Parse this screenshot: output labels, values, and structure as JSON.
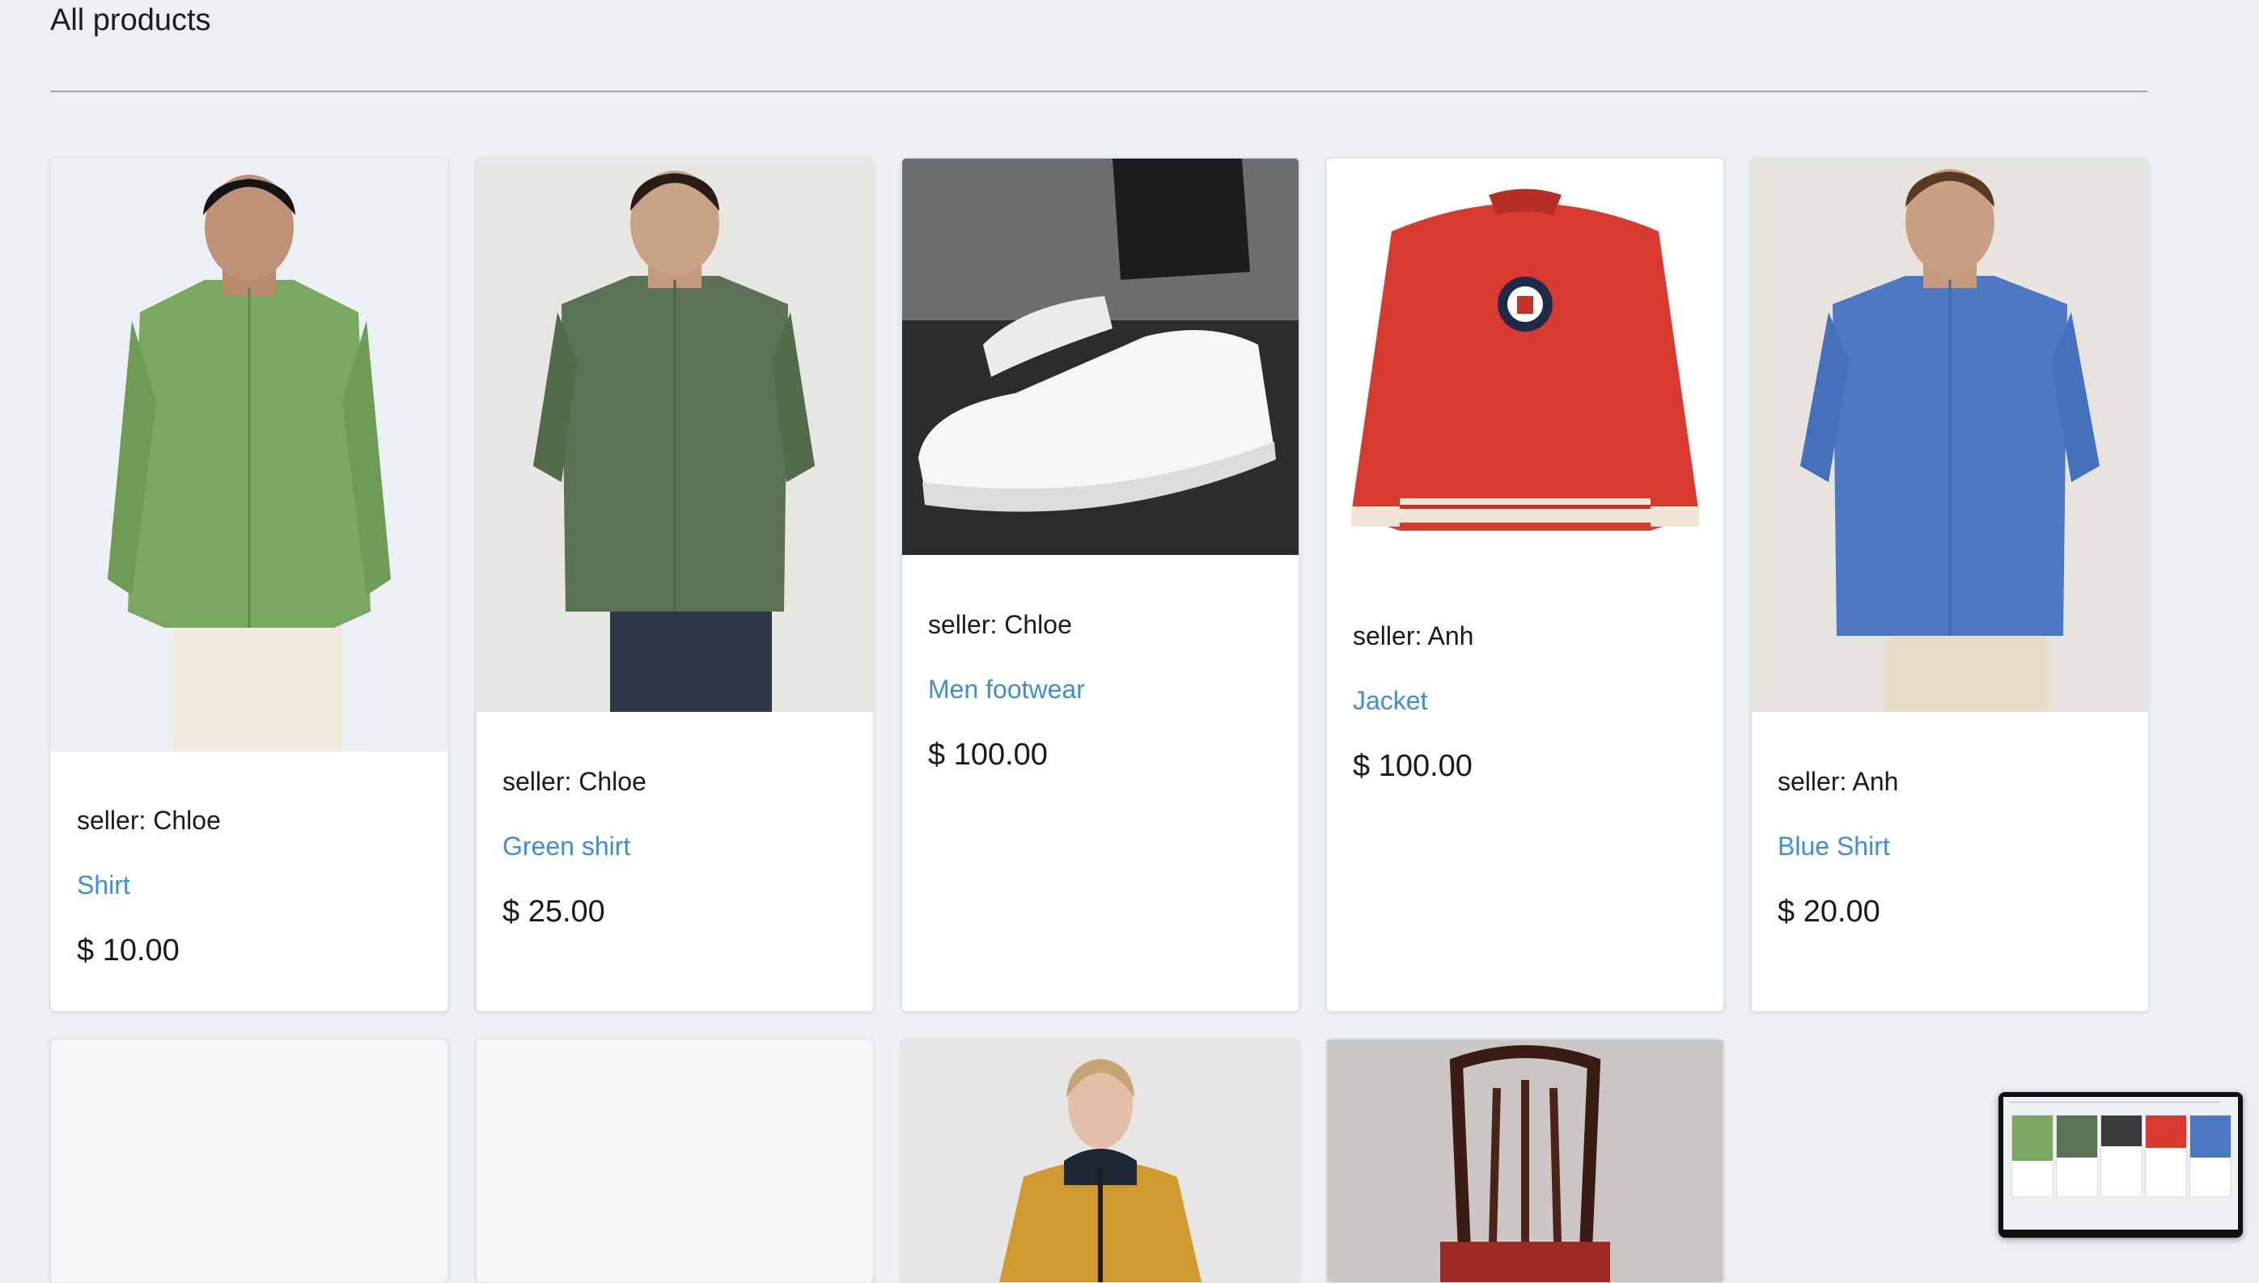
{
  "page": {
    "title": "All products"
  },
  "products": [
    {
      "seller": "seller: Chloe",
      "name": "Shirt",
      "price": "$ 10.00"
    },
    {
      "seller": "seller: Chloe",
      "name": "Green shirt",
      "price": "$ 25.00"
    },
    {
      "seller": "seller: Chloe",
      "name": "Men footwear",
      "price": "$ 100.00"
    },
    {
      "seller": "seller: Anh",
      "name": "Jacket",
      "price": "$ 100.00"
    },
    {
      "seller": "seller: Anh",
      "name": "Blue Shirt",
      "price": "$ 20.00"
    }
  ],
  "colors": {
    "background": "#ecf0f2",
    "link": "#3f8dd6",
    "card": "#ffffff"
  },
  "icons": [
    "screen-preview-thumbnail"
  ]
}
